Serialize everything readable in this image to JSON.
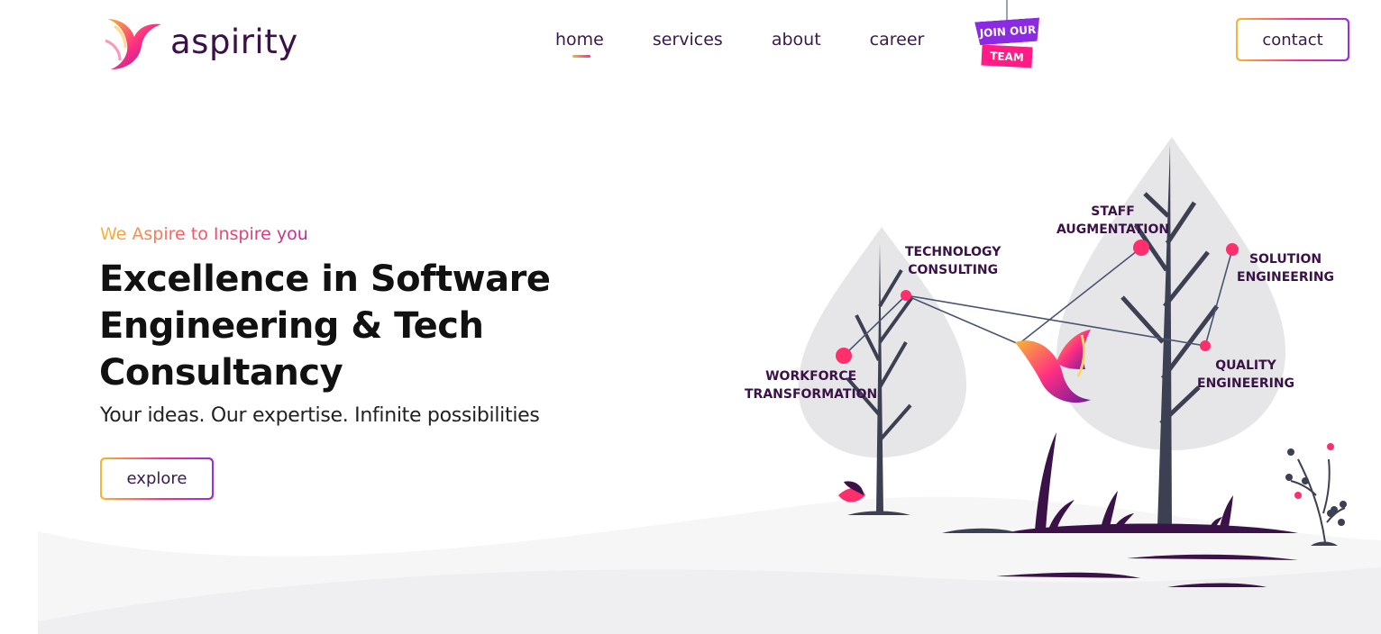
{
  "brand": {
    "name": "aspirity",
    "colors": {
      "primary": "#3a1247",
      "accent_orange": "#f7b733",
      "accent_pink": "#ff2e83",
      "accent_purple": "#9b2ce0"
    }
  },
  "nav": {
    "items": [
      {
        "label": "home",
        "active": true
      },
      {
        "label": "services",
        "active": false
      },
      {
        "label": "about",
        "active": false
      },
      {
        "label": "career",
        "active": false
      }
    ],
    "join_badge": {
      "line1": "JOIN OUR",
      "line2": "TEAM"
    },
    "contact_label": "contact"
  },
  "hero": {
    "tagline": "We Aspire to Inspire you",
    "headline_lines": [
      "Excellence in Software",
      "Engineering & Tech",
      "Consultancy"
    ],
    "subline": "Your ideas. Our expertise. Infinite possibilities",
    "cta_label": "explore"
  },
  "services": [
    {
      "line1": "TECHNOLOGY",
      "line2": "CONSULTING"
    },
    {
      "line1": "STAFF",
      "line2": "AUGMENTATION"
    },
    {
      "line1": "SOLUTION",
      "line2": "ENGINEERING"
    },
    {
      "line1": "QUALITY",
      "line2": "ENGINEERING"
    },
    {
      "line1": "WORKFORCE",
      "line2": "TRANSFORMATION"
    }
  ]
}
